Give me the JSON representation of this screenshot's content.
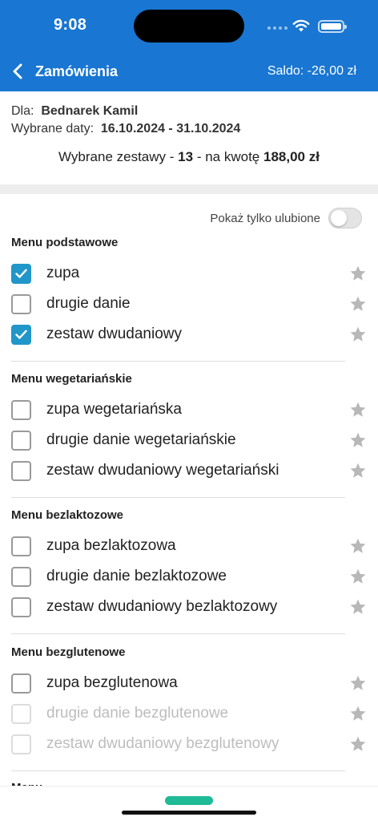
{
  "status_bar": {
    "time": "9:08"
  },
  "header": {
    "title": "Zamówienia",
    "balance": "Saldo: -26,00 zł"
  },
  "summary": {
    "for_label": "Dla:",
    "for_name": "Bednarek Kamil",
    "dates_label": "Wybrane daty:",
    "dates_value": "16.10.2024 - 31.10.2024",
    "total_prefix": "Wybrane zestawy -",
    "total_count": "13",
    "total_middle": "- na kwotę",
    "total_amount": "188,00 zł"
  },
  "favorites_toggle": {
    "label": "Pokaż tylko ulubione",
    "on": false
  },
  "sections": [
    {
      "title": "Menu podstawowe",
      "items": [
        {
          "label": "zupa",
          "checked": true,
          "disabled": false
        },
        {
          "label": "drugie danie",
          "checked": false,
          "disabled": false
        },
        {
          "label": "zestaw dwudaniowy",
          "checked": true,
          "disabled": false
        }
      ]
    },
    {
      "title": "Menu wegetariańskie",
      "items": [
        {
          "label": "zupa wegetariańska",
          "checked": false,
          "disabled": false
        },
        {
          "label": "drugie danie wegetariańskie",
          "checked": false,
          "disabled": false
        },
        {
          "label": "zestaw dwudaniowy wegetariański",
          "checked": false,
          "disabled": false
        }
      ]
    },
    {
      "title": "Menu bezlaktozowe",
      "items": [
        {
          "label": "zupa bezlaktozowa",
          "checked": false,
          "disabled": false
        },
        {
          "label": "drugie danie bezlaktozowe",
          "checked": false,
          "disabled": false
        },
        {
          "label": "zestaw dwudaniowy bezlaktozowy",
          "checked": false,
          "disabled": false
        }
      ]
    },
    {
      "title": "Menu bezglutenowe",
      "items": [
        {
          "label": "zupa bezglutenowa",
          "checked": false,
          "disabled": false
        },
        {
          "label": "drugie danie bezglutenowe",
          "checked": false,
          "disabled": true
        },
        {
          "label": "zestaw dwudaniowy bezglutenowy",
          "checked": false,
          "disabled": true
        }
      ]
    }
  ],
  "colors": {
    "header_bg": "#1976d2",
    "checkbox_checked": "#2196c9",
    "star": "#b8b8b8",
    "bottom_pill": "#1fba96"
  },
  "icons": {
    "back": "chevron-left-icon",
    "favorite": "star-icon",
    "check": "checkmark-icon"
  }
}
